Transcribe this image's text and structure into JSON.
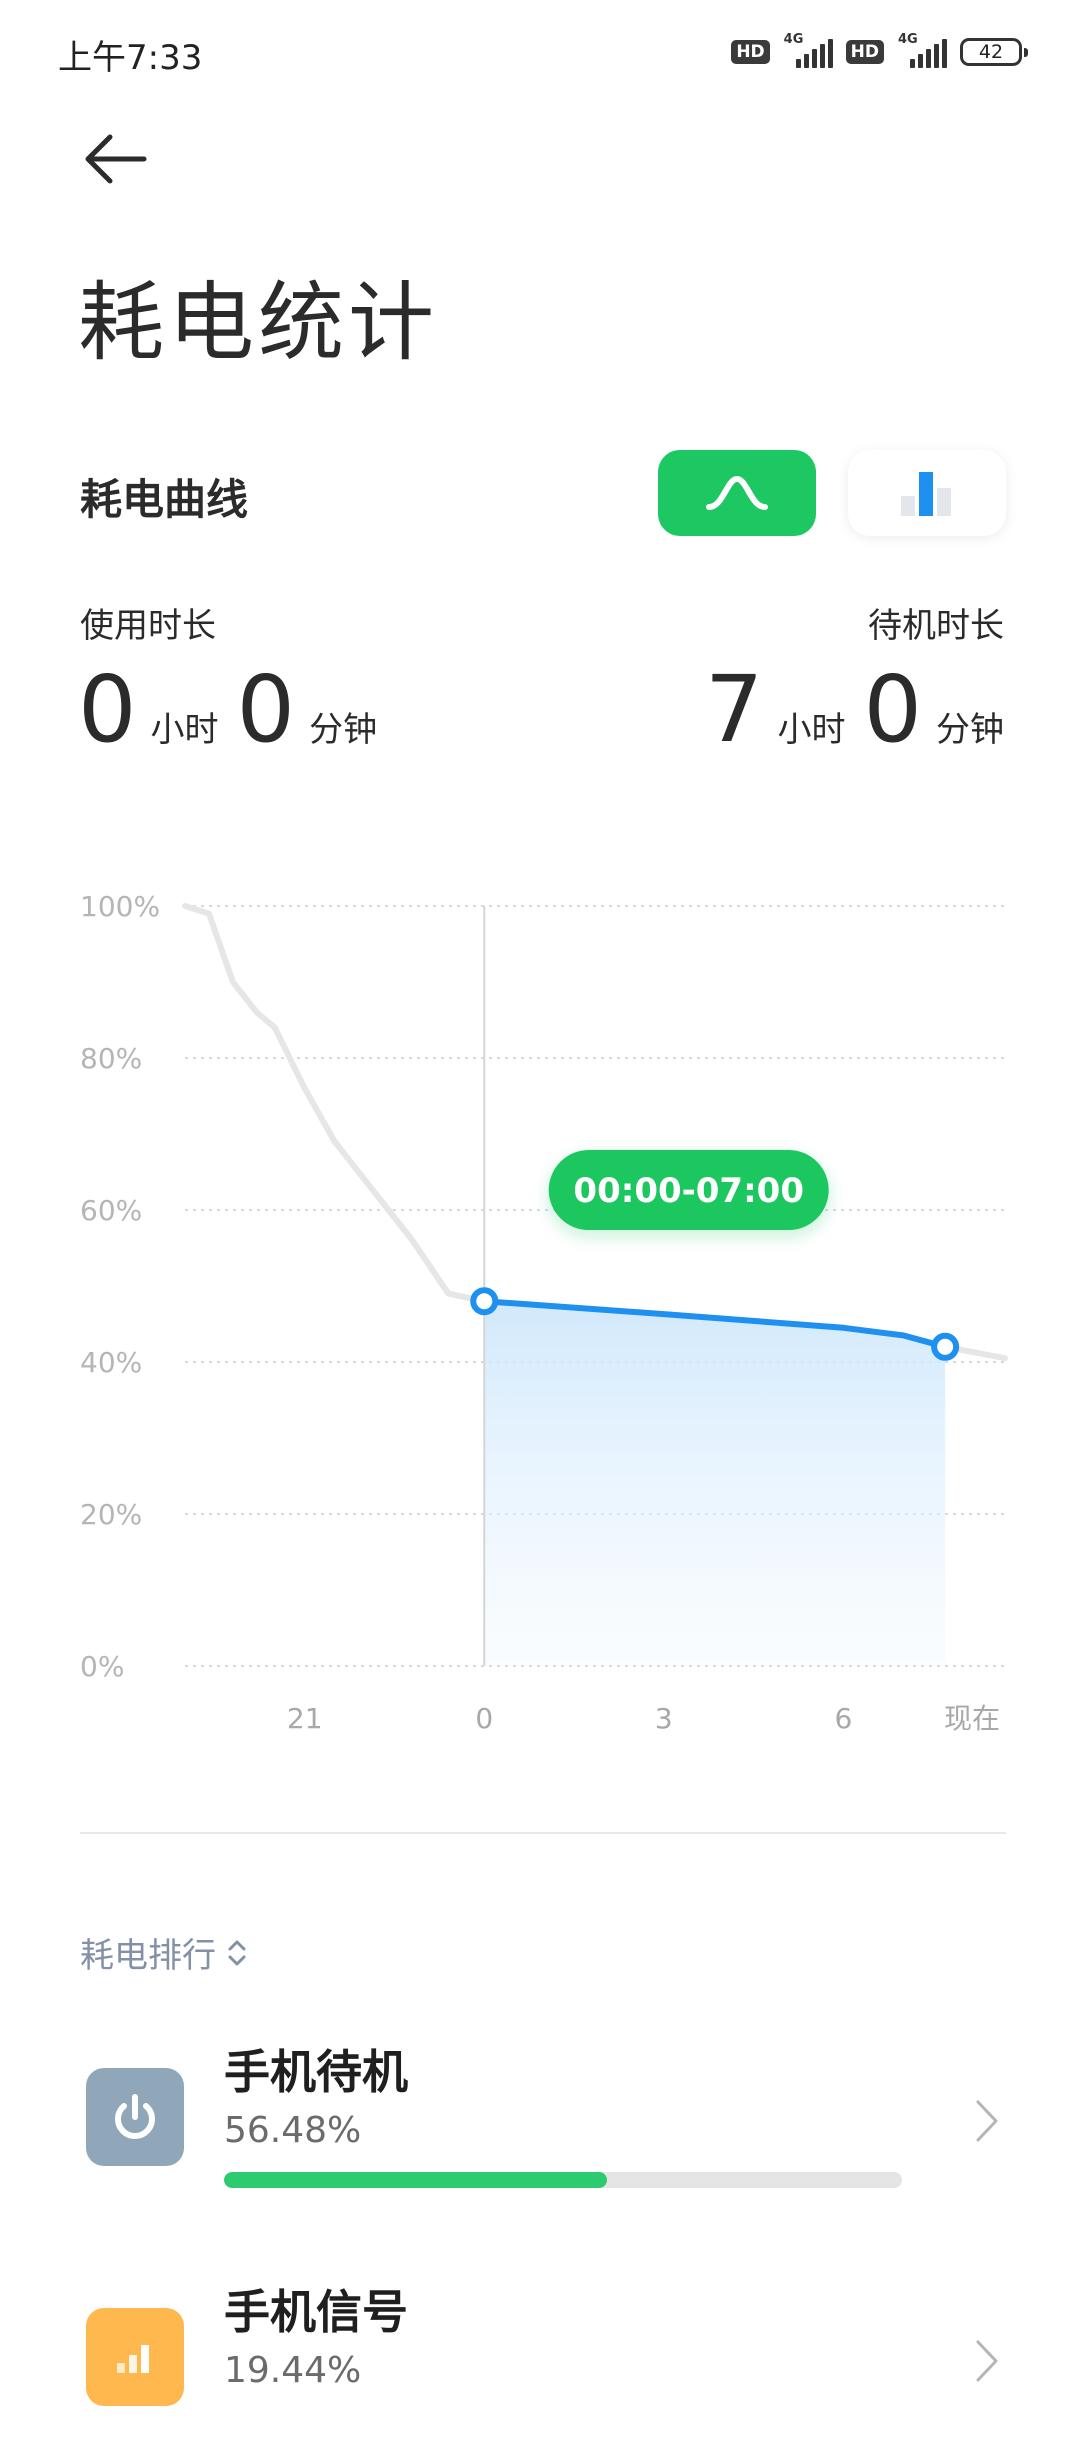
{
  "status_bar": {
    "time": "上午7:33",
    "hd_label": "HD",
    "network_label": "4G",
    "battery_level": "42"
  },
  "header": {
    "back_icon": "arrow-left-icon",
    "title": "耗电统计"
  },
  "curve_section": {
    "title": "耗电曲线",
    "toggle_curve_icon": "curve-icon",
    "toggle_bar_icon": "bar-chart-icon",
    "active_toggle": "curve",
    "accent_color": "#1dc761"
  },
  "stats": {
    "usage_label": "使用时长",
    "usage_hours": "0",
    "usage_minutes": "0",
    "standby_label": "待机时长",
    "standby_hours": "7",
    "standby_minutes": "0",
    "hour_unit": "小时",
    "minute_unit": "分钟"
  },
  "chart_data": {
    "type": "line",
    "y_ticks": [
      "100%",
      "80%",
      "60%",
      "40%",
      "20%",
      "0%"
    ],
    "x_ticks": [
      "21",
      "0",
      "3",
      "6",
      "现在"
    ],
    "ylim": [
      0,
      100
    ],
    "xlim": [
      19,
      7.7
    ],
    "series": [
      {
        "points": [
          [
            19.0,
            100
          ],
          [
            19.4,
            99
          ],
          [
            19.8,
            90
          ],
          [
            20.2,
            86
          ],
          [
            20.5,
            84
          ],
          [
            21.0,
            76
          ],
          [
            21.5,
            69
          ],
          [
            22.2,
            62
          ],
          [
            22.8,
            56
          ],
          [
            23.4,
            49
          ],
          [
            24.0,
            48
          ]
        ],
        "color": "#e6e6e6"
      },
      {
        "points": [
          [
            24.0,
            48
          ],
          [
            27.0,
            46.3
          ],
          [
            30.0,
            44.5
          ],
          [
            31.0,
            43.5
          ],
          [
            31.7,
            42
          ]
        ],
        "color": "#1e90f0"
      }
    ],
    "highlight_range": "00:00-07:00",
    "grid": true
  },
  "ranking": {
    "header": "耗电排行",
    "sort_icon": "sort-updown-icon",
    "items": [
      {
        "name": "手机待机",
        "percent": "56.48%",
        "fraction": 0.5648,
        "icon": "power-icon",
        "icon_color": "#90a7ba"
      },
      {
        "name": "手机信号",
        "percent": "19.44%",
        "fraction": 0.1944,
        "icon": "signal-bars-icon",
        "icon_color": "#ffb84d"
      }
    ]
  }
}
